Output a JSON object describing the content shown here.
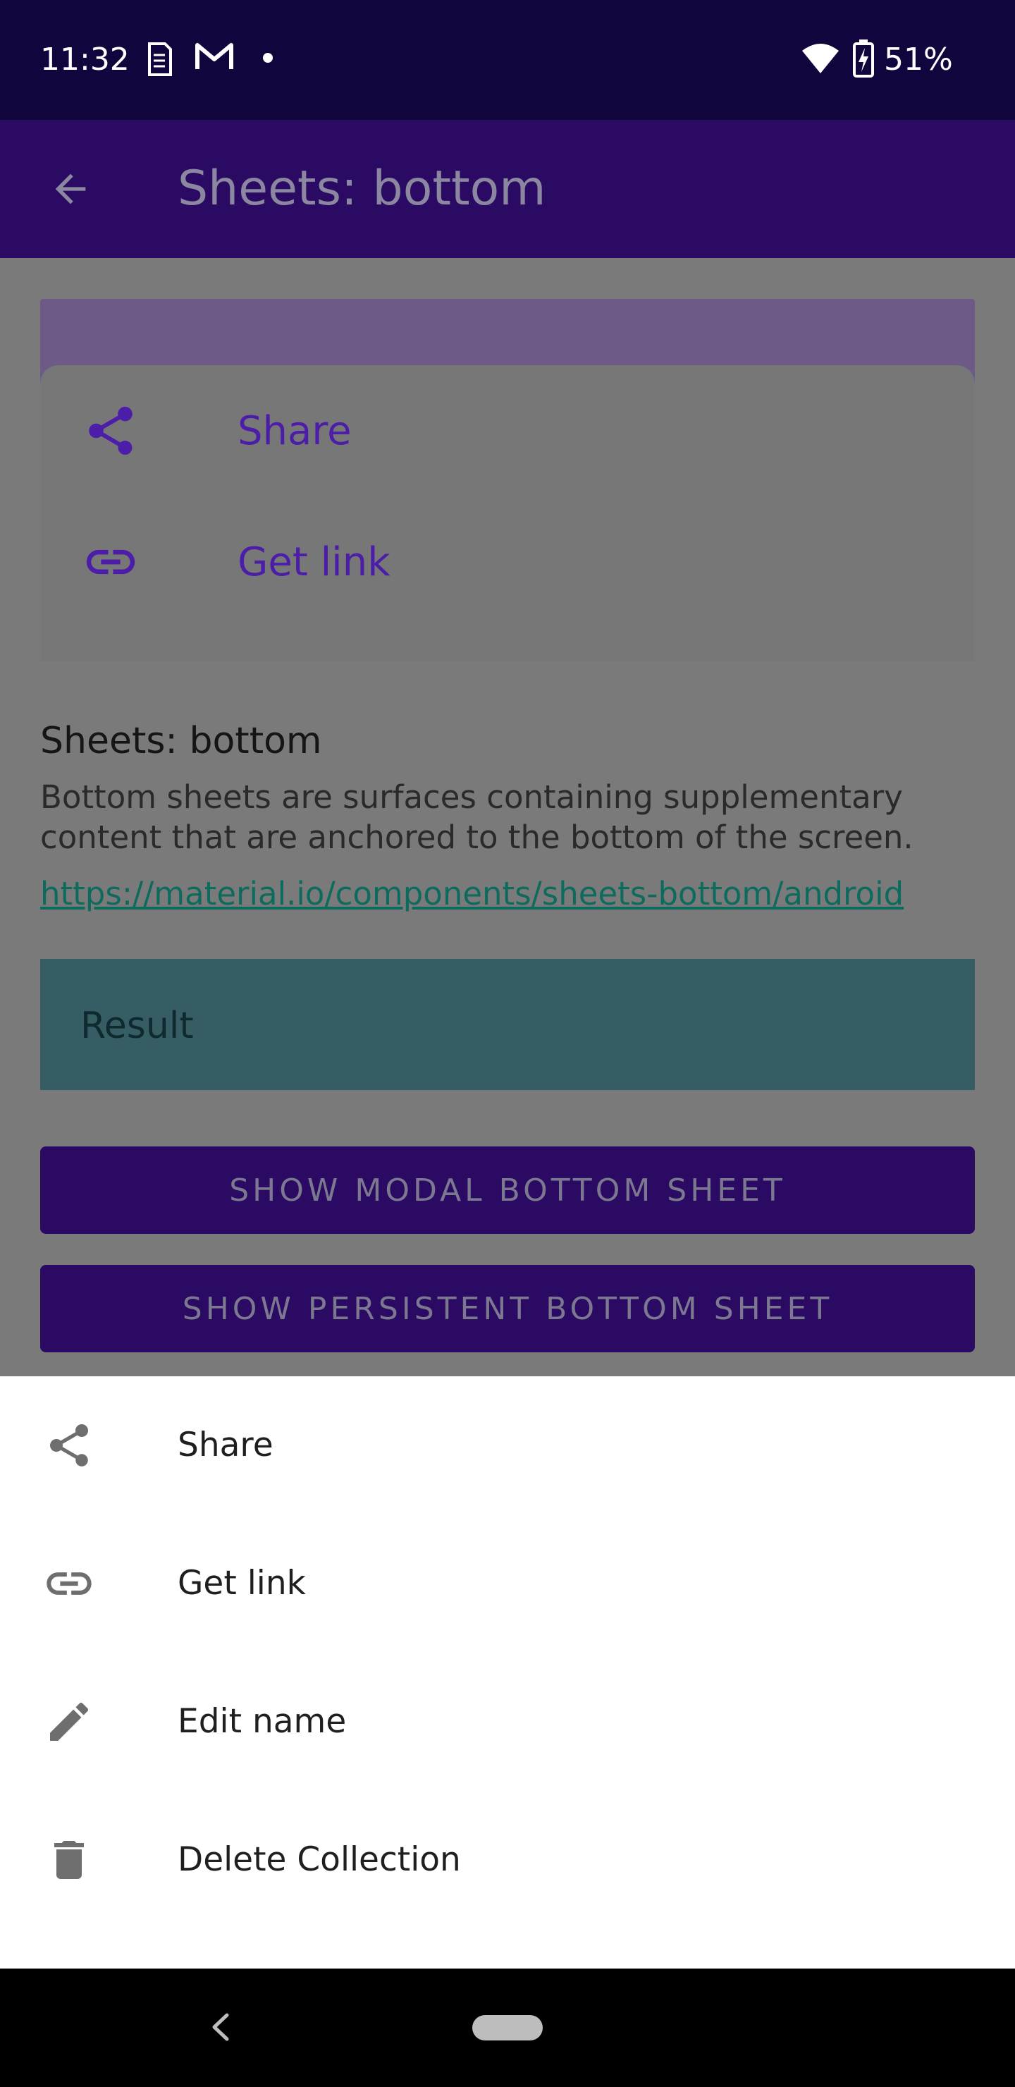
{
  "status_bar": {
    "time": "11:32",
    "battery": "51%",
    "icons": [
      "sim-card-icon",
      "gmail-icon",
      "dot-icon",
      "wifi-icon",
      "battery-charging-icon"
    ]
  },
  "app_bar": {
    "title": "Sheets: bottom",
    "back_icon": "arrow-back-icon"
  },
  "persistent_sheet": {
    "items": [
      {
        "label": "Share",
        "icon": "share-icon"
      },
      {
        "label": "Get link",
        "icon": "link-icon"
      }
    ]
  },
  "description": {
    "title": "Sheets: bottom",
    "text": "Bottom sheets are surfaces containing supplementary content that are anchored to the bottom of the screen.",
    "link": "https://material.io/components/sheets-bottom/android"
  },
  "result": {
    "label": "Result"
  },
  "buttons": {
    "show_modal": "SHOW MODAL BOTTOM SHEET",
    "show_persistent": "SHOW PERSISTENT BOTTOM SHEET"
  },
  "modal_sheet": {
    "items": [
      {
        "label": "Share",
        "icon": "share-icon"
      },
      {
        "label": "Get link",
        "icon": "link-icon"
      },
      {
        "label": "Edit name",
        "icon": "pencil-icon"
      },
      {
        "label": "Delete Collection",
        "icon": "trash-icon"
      }
    ]
  },
  "colors": {
    "status_bar": "#12043d",
    "app_bar": "#2a0a63",
    "accent": "#4c1da8",
    "result_bg": "#375d64",
    "scrim_content": "#7a7a7a"
  }
}
